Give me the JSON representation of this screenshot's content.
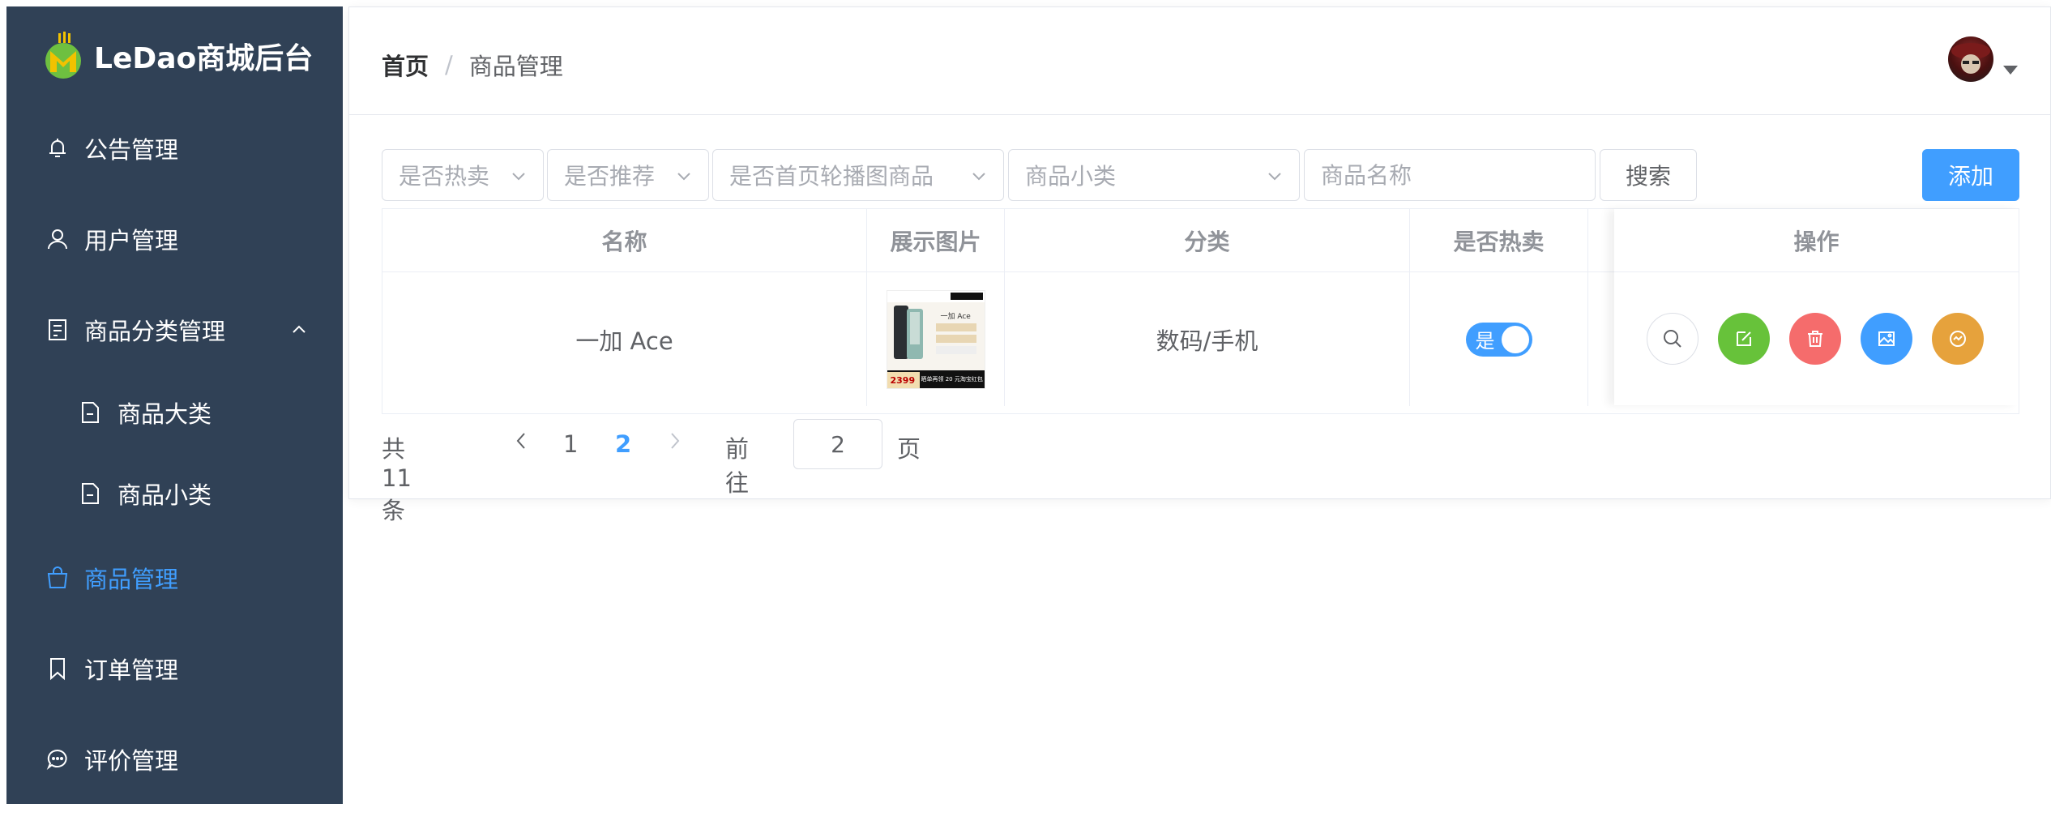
{
  "app": {
    "logo_text": "LeDao商城后台"
  },
  "sidebar": {
    "items": [
      {
        "label": "公告管理",
        "icon": "bell-icon"
      },
      {
        "label": "用户管理",
        "icon": "user-icon"
      },
      {
        "label": "商品分类管理",
        "icon": "document-list-icon"
      },
      {
        "label": "商品大类",
        "icon": "document-icon"
      },
      {
        "label": "商品小类",
        "icon": "document-icon"
      },
      {
        "label": "商品管理",
        "icon": "bag-icon",
        "active": true
      },
      {
        "label": "订单管理",
        "icon": "bookmark-icon"
      },
      {
        "label": "评价管理",
        "icon": "chat-icon"
      }
    ]
  },
  "header": {
    "breadcrumb_home": "首页",
    "breadcrumb_sep": "/",
    "breadcrumb_current": "商品管理"
  },
  "filters": {
    "hot_placeholder": "是否热卖",
    "recommend_placeholder": "是否推荐",
    "carousel_placeholder": "是否首页轮播图商品",
    "subcategory_placeholder": "商品小类",
    "name_placeholder": "商品名称",
    "search_label": "搜索",
    "add_label": "添加"
  },
  "table": {
    "columns": [
      "名称",
      "展示图片",
      "分类",
      "是否热卖",
      "操作"
    ],
    "rows": [
      {
        "name": "一加 Ace",
        "category": "数码/手机",
        "hot": "是",
        "image_title": "一加 Ace",
        "image_price": "2399",
        "image_banner": "晒单再领 20 元淘宝红包"
      }
    ]
  },
  "pagination": {
    "total": "共 11 条",
    "pages": [
      "1",
      "2"
    ],
    "current": "2",
    "goto_prefix": "前往",
    "goto_value": "2",
    "goto_suffix": "页"
  },
  "colors": {
    "sidebar_bg": "#304156",
    "primary": "#409eff",
    "success": "#67c23a",
    "danger": "#f56c6c",
    "warning": "#e6a23c"
  }
}
